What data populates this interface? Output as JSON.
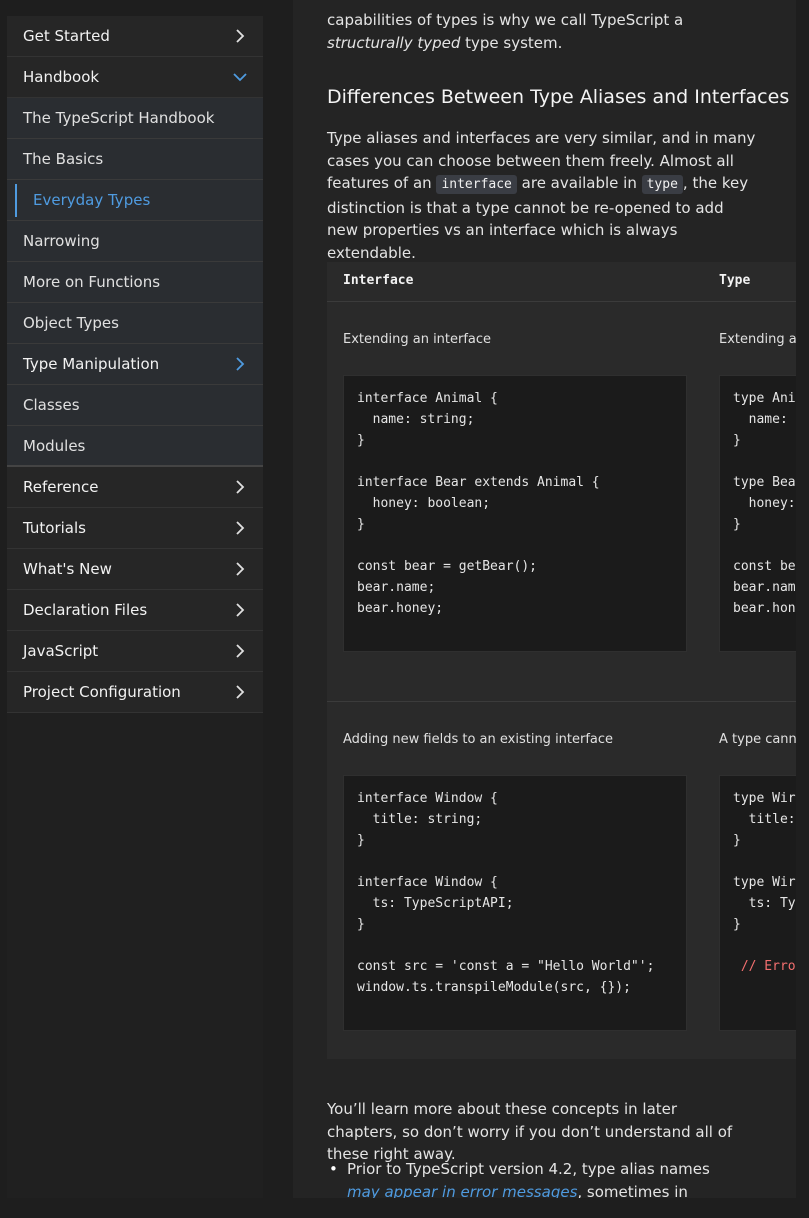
{
  "sidebar": {
    "top": [
      {
        "label": "Get Started",
        "icon": "chevron-right-icon"
      },
      {
        "label": "Handbook",
        "icon": "chevron-down-icon"
      }
    ],
    "handbook_items": [
      {
        "label": "The TypeScript Handbook"
      },
      {
        "label": "The Basics"
      },
      {
        "label": "Everyday Types",
        "active": true
      },
      {
        "label": "Narrowing"
      },
      {
        "label": "More on Functions"
      },
      {
        "label": "Object Types"
      }
    ],
    "type_manipulation": {
      "label": "Type Manipulation",
      "icon": "chevron-right-icon"
    },
    "handbook_items_2": [
      {
        "label": "Classes"
      },
      {
        "label": "Modules"
      }
    ],
    "bottom": [
      {
        "label": "Reference"
      },
      {
        "label": "Tutorials"
      },
      {
        "label": "What's New"
      },
      {
        "label": "Declaration Files"
      },
      {
        "label": "JavaScript"
      },
      {
        "label": "Project Configuration"
      }
    ]
  },
  "main": {
    "intro_part1": "capabilities of types is why we call TypeScript a ",
    "intro_em": "structurally typed",
    "intro_part2": " type system.",
    "heading": "Differences Between Type Aliases and Interfaces",
    "para_part1": "Type aliases and interfaces are very similar, and in many cases you can choose between them freely. Almost all features of an ",
    "para_code1": "interface",
    "para_part2": " are available in ",
    "para_code2": "type",
    "para_part3": ", the key distinction is that a type cannot be re-opened to add new properties vs an interface which is always extendable.",
    "table": {
      "col1": "Interface",
      "col2": "Type",
      "row1": {
        "label1": "Extending an interface",
        "label2": "Extending a",
        "code1": "interface Animal {\n  name: string;\n}\n\ninterface Bear extends Animal {\n  honey: boolean;\n}\n\nconst bear = getBear();\nbear.name;\nbear.honey;",
        "code2": "type Ani\n  name:\n}\n\ntype Bea\n  honey:\n}\n\nconst be\nbear.nam\nbear.hon"
      },
      "row2": {
        "label1": "Adding new fields to an existing interface",
        "label2": "A type canno",
        "code1": "interface Window {\n  title: string;\n}\n\ninterface Window {\n  ts: TypeScriptAPI;\n}\n\nconst src = 'const a = \"Hello World\"';\nwindow.ts.transpileModule(src, {});",
        "code2_plain": "type Wir\n  title:\n}\n\ntype Wir\n  ts: Ty\n}\n\n",
        "code2_error": " // Erro"
      }
    },
    "after_table": "You’ll learn more about these concepts in later chapters, so don’t worry if you don’t understand all of these right away.",
    "bullet_part1": "Prior to TypeScript version 4.2, type alias names ",
    "bullet_link": "may appear in error messages",
    "bullet_part2": ", sometimes in place of the"
  }
}
